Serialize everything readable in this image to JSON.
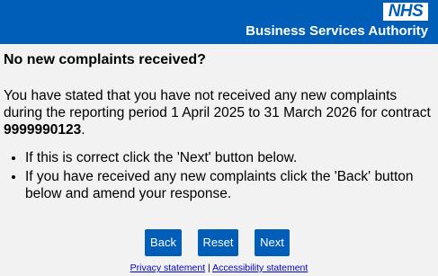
{
  "header": {
    "logo_text": "NHS",
    "org_name": "Business Services Authority",
    "background_color": "#005eb8"
  },
  "main": {
    "title": "No new complaints received?",
    "statement_text": "You have stated that you have not received any new complaints during the reporting period 1 April 2025 to 31 March 2026 for contract ",
    "contract_number": "9999990123",
    "statement_end": ".",
    "instructions": [
      "If this is correct click the 'Next' button below.",
      "If you have received any new complaints click the 'Back' button below and amend your response."
    ]
  },
  "buttons": {
    "back": "Back",
    "reset": "Reset",
    "next": "Next",
    "color": "#005eb8"
  },
  "footer": {
    "privacy": "Privacy statement",
    "separator": " | ",
    "accessibility": "Accessibility statement"
  }
}
